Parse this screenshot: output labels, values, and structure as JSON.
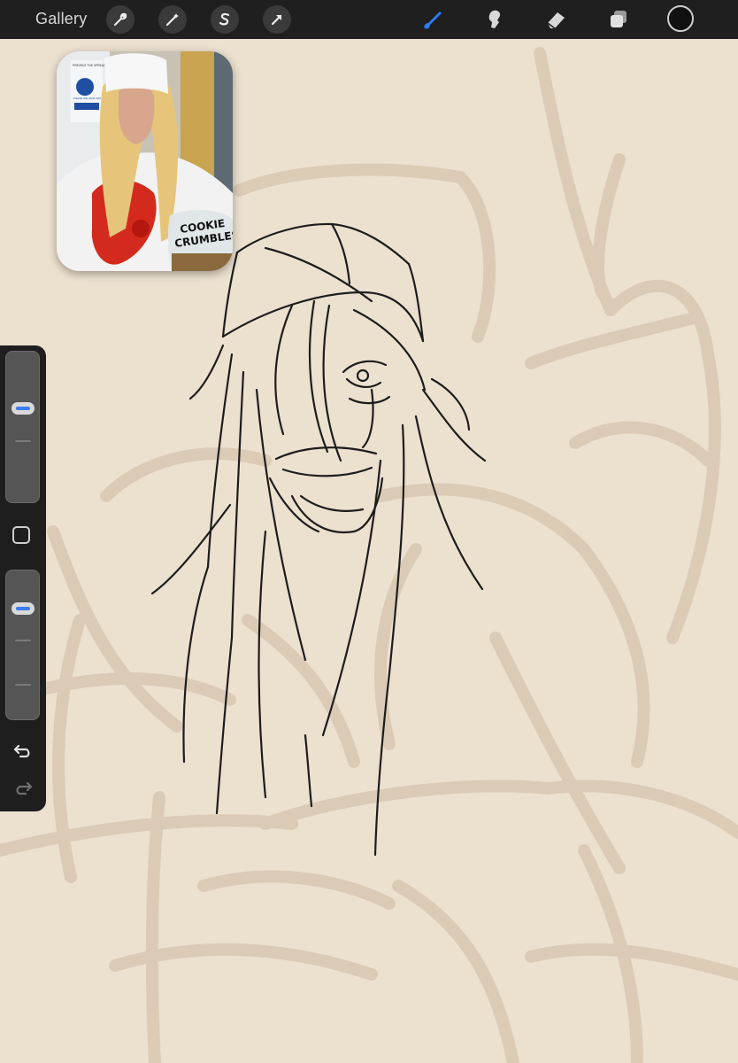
{
  "toolbar": {
    "gallery_label": "Gallery",
    "left_tools": [
      "wrench-icon",
      "magic-wand-icon",
      "selection-s-icon",
      "transform-arrow-icon"
    ],
    "right_tools": [
      "brush-icon",
      "smudge-icon",
      "eraser-icon",
      "layers-icon"
    ],
    "active_tool": "brush-icon",
    "accent_color": "#2f7cf6",
    "current_color": "#111111"
  },
  "reference": {
    "sign_text": "PREVENT THE SPREAD OF CORONAVIRUS",
    "sign_text_2": "PLEASE USE HAND SANITISER BEFORE ENTERING",
    "jar_label_line1": "COOKIE",
    "jar_label_line2": "CRUMBLES"
  },
  "sidebar": {
    "brush_size_level": 0.64,
    "opacity_level": 0.78,
    "icons": [
      "modifier-square-icon",
      "undo-icon",
      "redo-icon"
    ]
  },
  "canvas": {
    "background": "#ece0cf",
    "sketch_color": "#1d1d1d",
    "underlayer_color": "#d9c8b2"
  }
}
